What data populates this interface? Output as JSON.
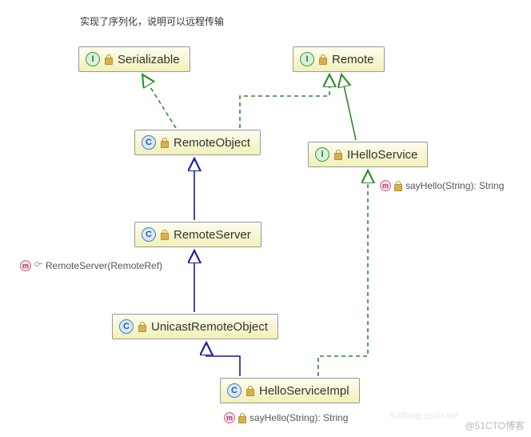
{
  "annotation": "实现了序列化，说明可以远程传输",
  "nodes": {
    "serializable": {
      "type": "I",
      "label": "Serializable"
    },
    "remote": {
      "type": "I",
      "label": "Remote"
    },
    "remoteObject": {
      "type": "C",
      "label": "RemoteObject"
    },
    "iHelloService": {
      "type": "I",
      "label": "IHelloService"
    },
    "remoteServer": {
      "type": "C",
      "label": "RemoteServer"
    },
    "unicastRemoteObject": {
      "type": "C",
      "label": "UnicastRemoteObject"
    },
    "helloServiceImpl": {
      "type": "C",
      "label": "HelloServiceImpl"
    }
  },
  "methods": {
    "remoteServerCtor": "RemoteServer(RemoteRef)",
    "sayHello1": "sayHello(String): String",
    "sayHello2": "sayHello(String): String"
  },
  "edges": [
    {
      "from": "remoteObject",
      "to": "serializable",
      "style": "implements"
    },
    {
      "from": "remoteObject",
      "to": "remote",
      "style": "implements"
    },
    {
      "from": "iHelloService",
      "to": "remote",
      "style": "extends-interface"
    },
    {
      "from": "remoteServer",
      "to": "remoteObject",
      "style": "extends-class"
    },
    {
      "from": "unicastRemoteObject",
      "to": "remoteServer",
      "style": "extends-class"
    },
    {
      "from": "helloServiceImpl",
      "to": "unicastRemoteObject",
      "style": "extends-class"
    },
    {
      "from": "helloServiceImpl",
      "to": "iHelloService",
      "style": "implements"
    }
  ],
  "watermark": "@51CTO博客",
  "wm_faint": "s://blog.csdn.ne"
}
